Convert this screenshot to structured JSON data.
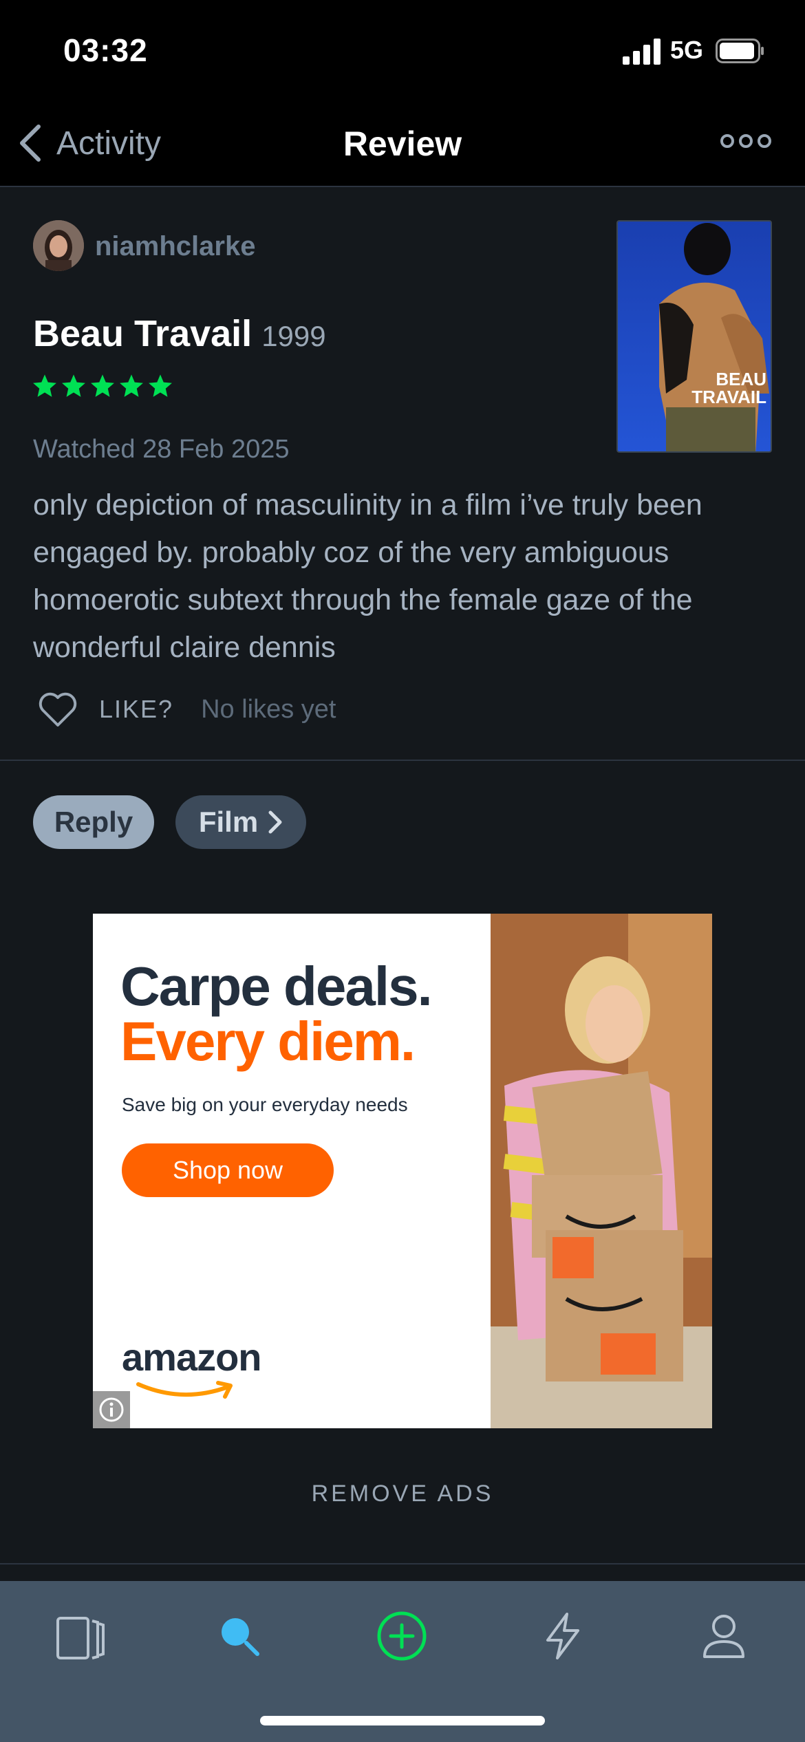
{
  "status_bar": {
    "time": "03:32",
    "network": "5G"
  },
  "nav": {
    "back_label": "Activity",
    "title": "Review"
  },
  "review": {
    "username": "niamhclarke",
    "film_title": "Beau Travail",
    "film_year": "1999",
    "rating_stars": 5,
    "watched": "Watched 28 Feb 2025",
    "text": "only depiction of masculinity in a film i’ve truly been engaged by. probably coz of the very ambiguous homoerotic subtext through the female gaze of the wonderful claire dennis",
    "like_label": "LIKE?",
    "likes_status": "No likes yet",
    "poster_text_line1": "BEAU",
    "poster_text_line2": "TRAVAIL"
  },
  "actions": {
    "reply_label": "Reply",
    "film_label": "Film"
  },
  "ad": {
    "headline1": "Carpe deals.",
    "headline2": "Every diem.",
    "subtext": "Save big on your everyday needs",
    "cta": "Shop now",
    "brand": "amazon"
  },
  "remove_ads_label": "REMOVE ADS",
  "tabs": [
    {
      "icon": "films-icon"
    },
    {
      "icon": "search-icon",
      "active": true
    },
    {
      "icon": "add-icon"
    },
    {
      "icon": "activity-icon"
    },
    {
      "icon": "profile-icon"
    }
  ],
  "colors": {
    "background": "#14181c",
    "star": "#00e054",
    "accent_blue": "#40bcf4",
    "tabbar": "#445566",
    "ad_orange": "#ff6200"
  }
}
